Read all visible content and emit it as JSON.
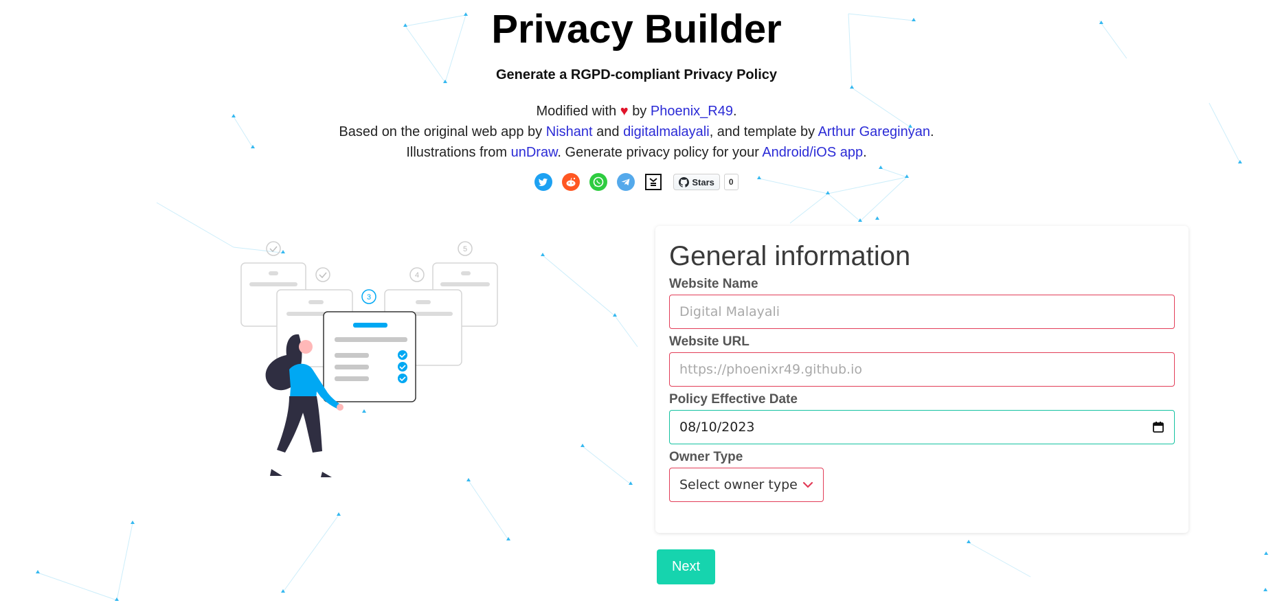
{
  "header": {
    "title": "Privacy Builder",
    "subtitle": "Generate a RGPD-compliant Privacy Policy",
    "line1": {
      "prefix": "Modified with",
      "heart": "♥",
      "by": "by",
      "author": "Phoenix_R49",
      "end": "."
    },
    "line2": {
      "prefix": "Based on the original web app by",
      "link1": "Nishant",
      "and": "and",
      "link2": "digitalmalayali",
      "middle": ", and template by",
      "link3": "Arthur Gareginyan",
      "end": "."
    },
    "line3": {
      "prefix": "Illustrations from",
      "link1": "unDraw",
      "middle": ". Generate privacy policy for your",
      "link2": "Android/iOS app",
      "end": "."
    }
  },
  "social": {
    "icons": [
      "twitter-icon",
      "reddit-icon",
      "whatsapp-icon",
      "telegram-icon",
      "hackernews-icon",
      "github-icon"
    ],
    "github": {
      "label": "Stars",
      "count": "0"
    }
  },
  "illustration": {
    "step3": "3",
    "step4": "4",
    "step5": "5"
  },
  "form": {
    "title": "General information",
    "website_name": {
      "label": "Website Name",
      "placeholder": "Digital Malayali"
    },
    "website_url": {
      "label": "Website URL",
      "placeholder": "https://phoenixr49.github.io"
    },
    "effective_date": {
      "label": "Policy Effective Date",
      "value": "08/10/2023"
    },
    "owner_type": {
      "label": "Owner Type",
      "selected": "Select owner type"
    },
    "next_label": "Next"
  },
  "colors": {
    "accent": "#16d4ae",
    "error_border": "#e23c57",
    "link": "#2b2bd6",
    "illustration_blue": "#00a8f3",
    "background_network": "#35b8f0"
  }
}
